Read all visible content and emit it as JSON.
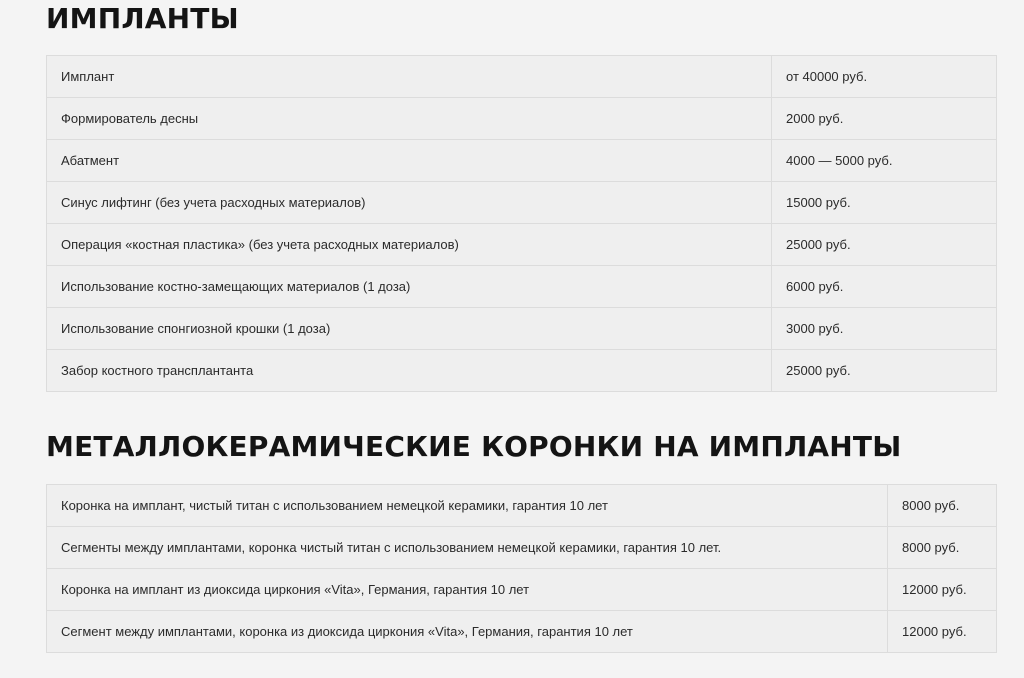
{
  "sections": [
    {
      "title": "ИМПЛАНТЫ",
      "rows": [
        {
          "service": "Имплант",
          "price": "от 40000 руб."
        },
        {
          "service": "Формирователь десны",
          "price": "2000 руб."
        },
        {
          "service": "Абатмент",
          "price": "4000 — 5000 руб."
        },
        {
          "service": "Синус лифтинг (без учета расходных материалов)",
          "price": "15000 руб."
        },
        {
          "service": "Операция «костная пластика» (без учета расходных материалов)",
          "price": "25000 руб."
        },
        {
          "service": "Использование костно-замещающих материалов (1 доза)",
          "price": "6000 руб."
        },
        {
          "service": "Использование спонгиозной крошки (1 доза)",
          "price": "3000 руб."
        },
        {
          "service": "Забор костного трансплантанта",
          "price": "25000 руб."
        }
      ]
    },
    {
      "title": "МЕТАЛЛОКЕРАМИЧЕСКИЕ КОРОНКИ НА ИМПЛАНТЫ",
      "rows": [
        {
          "service": "Коронка на имплант, чистый титан с использованием немецкой керамики, гарантия 10 лет",
          "price": "8000 руб."
        },
        {
          "service": "Сегменты между имплантами, коронка чистый титан с использованием немецкой керамики, гарантия 10 лет.",
          "price": "8000 руб."
        },
        {
          "service": "Коронка на имплант из диоксида циркония «Vita», Германия, гарантия 10 лет",
          "price": "12000 руб."
        },
        {
          "service": "Сегмент между имплантами, коронка из диоксида циркония «Vita», Германия, гарантия 10 лет",
          "price": "12000 руб."
        }
      ]
    }
  ]
}
